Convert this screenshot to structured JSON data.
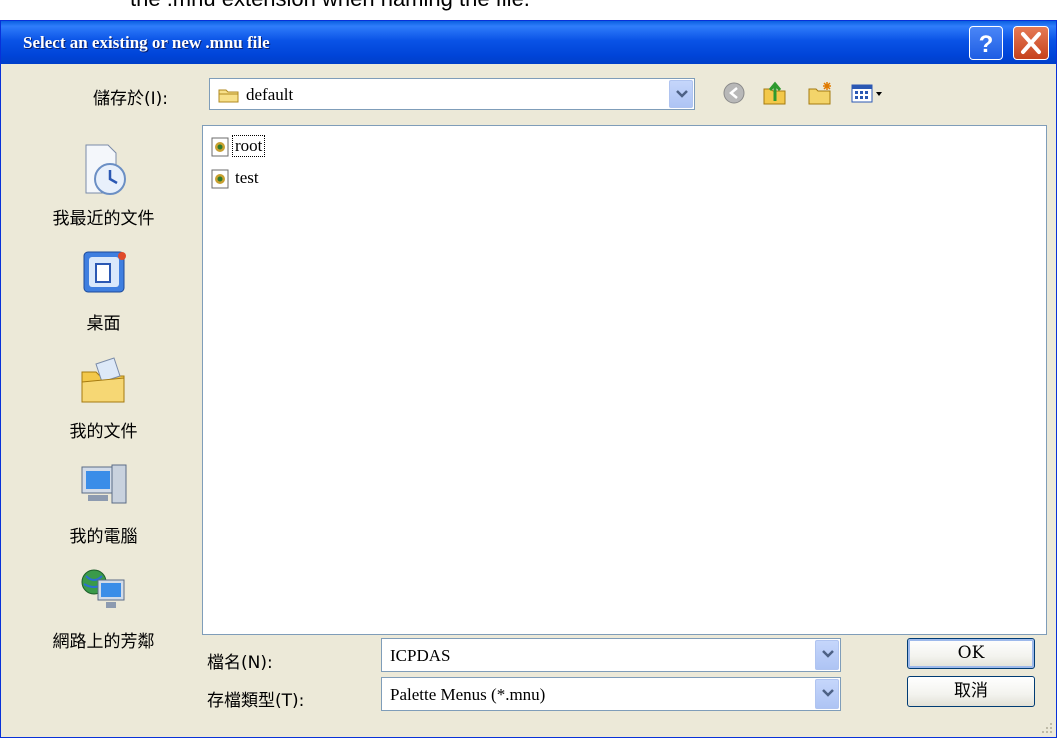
{
  "doc_text": "the .mnu extension when naming the file.",
  "dialog": {
    "title": "Select an existing or new .mnu file",
    "help_glyph": "?",
    "save_in_label": "儲存於(I):",
    "save_in_value": "default"
  },
  "toolbar": {
    "icons": [
      "back-icon",
      "up-folder-icon",
      "new-folder-icon",
      "view-menu-icon"
    ]
  },
  "places": [
    {
      "label": "我最近的文件",
      "icon": "recent-documents-icon"
    },
    {
      "label": "桌面",
      "icon": "desktop-icon"
    },
    {
      "label": "我的文件",
      "icon": "my-documents-icon"
    },
    {
      "label": "我的電腦",
      "icon": "my-computer-icon"
    },
    {
      "label": "網路上的芳鄰",
      "icon": "network-places-icon"
    }
  ],
  "files": [
    {
      "name": "root",
      "selected": true
    },
    {
      "name": "test",
      "selected": false
    }
  ],
  "filename": {
    "label": "檔名(N):",
    "value": "ICPDAS"
  },
  "filetype": {
    "label": "存檔類型(T):",
    "value": "Palette Menus (*.mnu)"
  },
  "buttons": {
    "ok": "OK",
    "cancel": "取消"
  },
  "colors": {
    "title_bar": "#0a53e6",
    "dialog_bg": "#ece9d8",
    "close_button": "#c6421d"
  }
}
